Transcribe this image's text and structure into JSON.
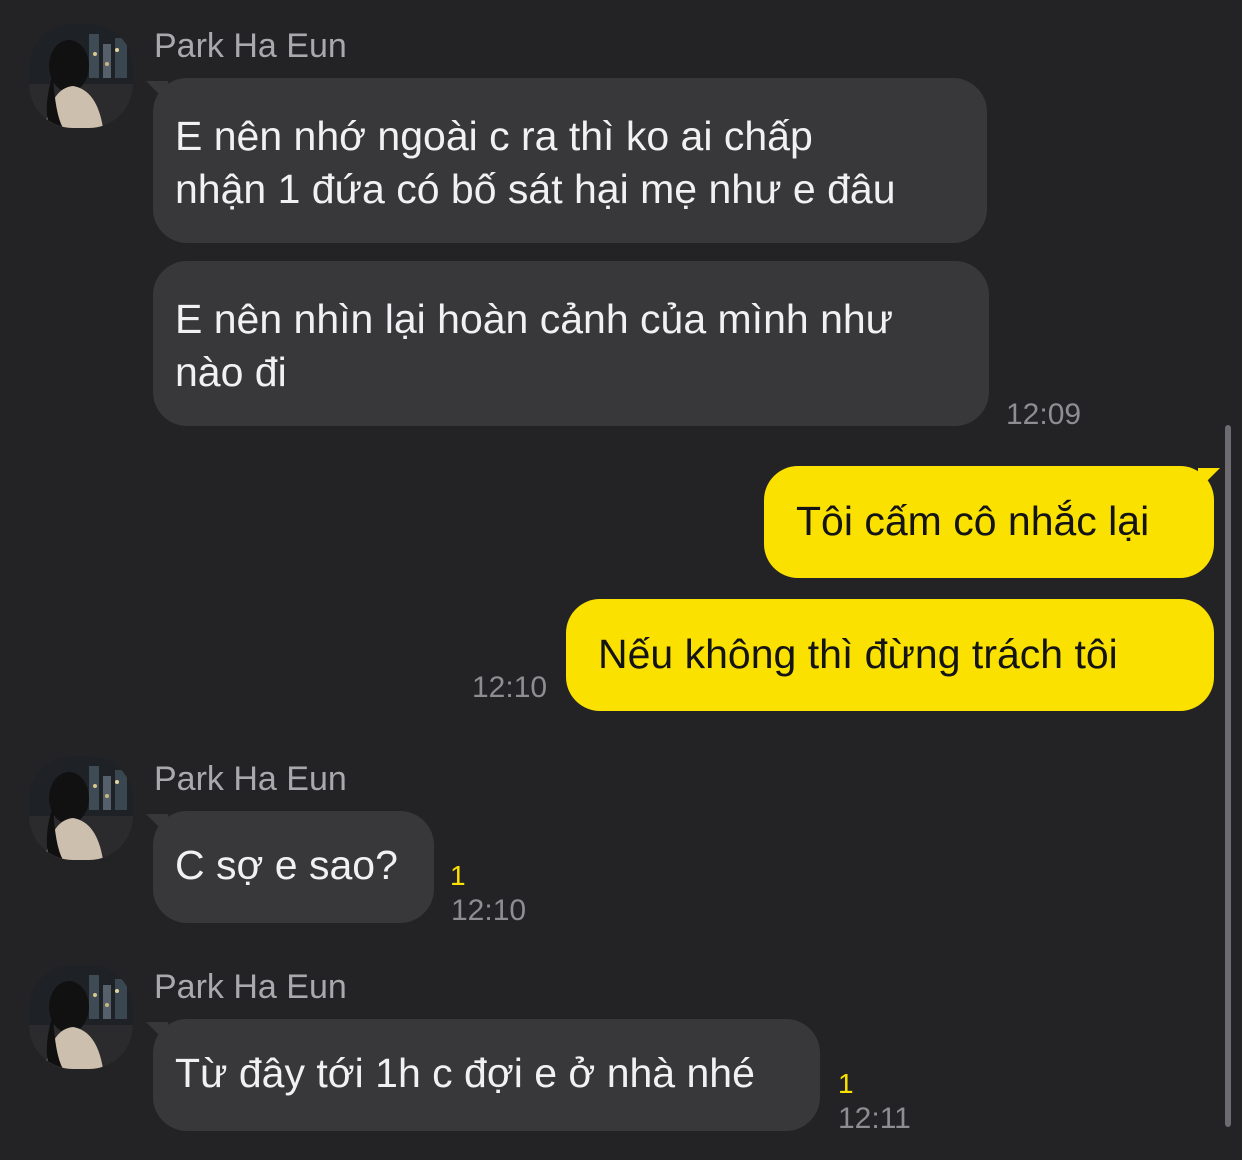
{
  "colors": {
    "background": "#232325",
    "incoming_bubble": "#38383b",
    "outgoing_bubble": "#fae100",
    "unread_count": "#fae100"
  },
  "messages": {
    "group1": {
      "sender": "Park Ha Eun",
      "avatar_icon": "profile-photo-avatar",
      "msg1_line1": "E nên nhớ ngoài c ra thì ko ai chấp",
      "msg1_line2": "nhận 1 đứa có bố sát hại mẹ như e đâu",
      "msg2_line1": "E nên nhìn lại hoàn cảnh của mình như",
      "msg2_line2": "nào đi",
      "time": "12:09"
    },
    "outgoing": {
      "msg1": "Tôi cấm cô nhắc lại",
      "msg2": "Nếu không thì đừng trách tôi",
      "time": "12:10"
    },
    "group2": {
      "sender": "Park Ha Eun",
      "avatar_icon": "profile-photo-avatar",
      "msg": "C sợ e sao?",
      "unread": "1",
      "time": "12:10"
    },
    "group3": {
      "sender": "Park Ha Eun",
      "avatar_icon": "profile-photo-avatar",
      "msg": "Từ đây tới 1h c đợi e ở nhà nhé",
      "unread": "1",
      "time": "12:11"
    }
  }
}
